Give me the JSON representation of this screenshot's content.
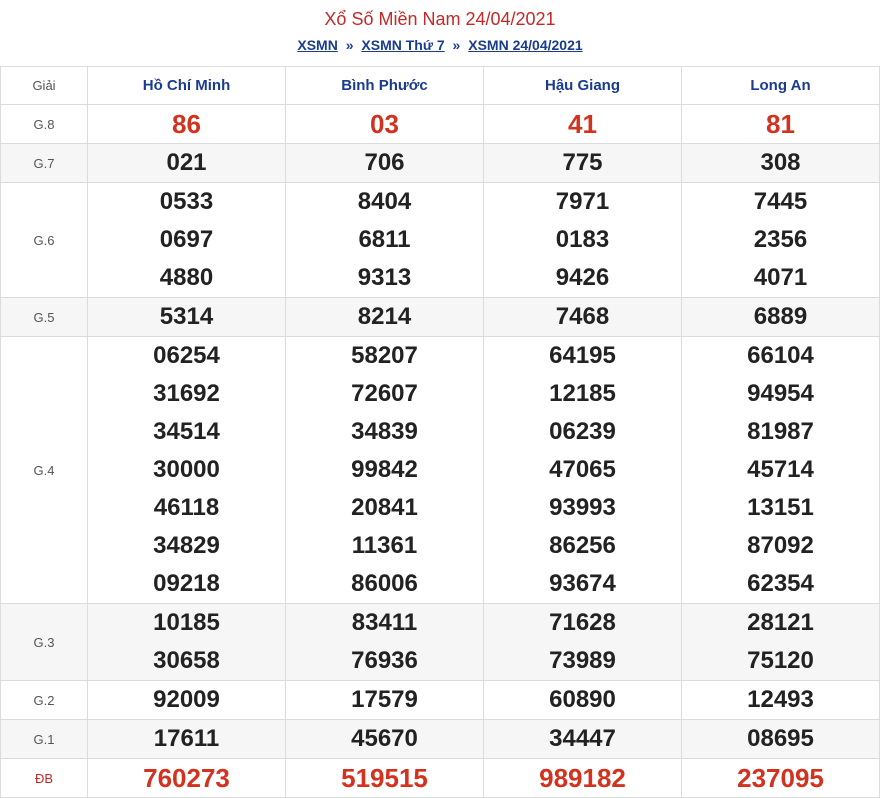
{
  "header": {
    "title": "Xổ Số Miền Nam 24/04/2021",
    "breadcrumb": [
      "XSMN",
      "XSMN Thứ 7",
      "XSMN 24/04/2021"
    ],
    "separator": "»"
  },
  "table": {
    "label_header": "Giải",
    "provinces": [
      "Hồ Chí Minh",
      "Bình Phước",
      "Hậu Giang",
      "Long An"
    ],
    "prizes": [
      {
        "label": "G.8",
        "highlight": true,
        "cols": [
          [
            "86"
          ],
          [
            "03"
          ],
          [
            "41"
          ],
          [
            "81"
          ]
        ]
      },
      {
        "label": "G.7",
        "cols": [
          [
            "021"
          ],
          [
            "706"
          ],
          [
            "775"
          ],
          [
            "308"
          ]
        ]
      },
      {
        "label": "G.6",
        "cols": [
          [
            "0533",
            "0697",
            "4880"
          ],
          [
            "8404",
            "6811",
            "9313"
          ],
          [
            "7971",
            "0183",
            "9426"
          ],
          [
            "7445",
            "2356",
            "4071"
          ]
        ]
      },
      {
        "label": "G.5",
        "cols": [
          [
            "5314"
          ],
          [
            "8214"
          ],
          [
            "7468"
          ],
          [
            "6889"
          ]
        ]
      },
      {
        "label": "G.4",
        "cols": [
          [
            "06254",
            "31692",
            "34514",
            "30000",
            "46118",
            "34829",
            "09218"
          ],
          [
            "58207",
            "72607",
            "34839",
            "99842",
            "20841",
            "11361",
            "86006"
          ],
          [
            "64195",
            "12185",
            "06239",
            "47065",
            "93993",
            "86256",
            "93674"
          ],
          [
            "66104",
            "94954",
            "81987",
            "45714",
            "13151",
            "87092",
            "62354"
          ]
        ]
      },
      {
        "label": "G.3",
        "cols": [
          [
            "10185",
            "30658"
          ],
          [
            "83411",
            "76936"
          ],
          [
            "71628",
            "73989"
          ],
          [
            "28121",
            "75120"
          ]
        ]
      },
      {
        "label": "G.2",
        "cols": [
          [
            "92009"
          ],
          [
            "17579"
          ],
          [
            "60890"
          ],
          [
            "12493"
          ]
        ]
      },
      {
        "label": "G.1",
        "cols": [
          [
            "17611"
          ],
          [
            "45670"
          ],
          [
            "34447"
          ],
          [
            "08695"
          ]
        ]
      },
      {
        "label": "ĐB",
        "highlight": true,
        "special": true,
        "cols": [
          [
            "760273"
          ],
          [
            "519515"
          ],
          [
            "989182"
          ],
          [
            "237095"
          ]
        ]
      }
    ]
  }
}
